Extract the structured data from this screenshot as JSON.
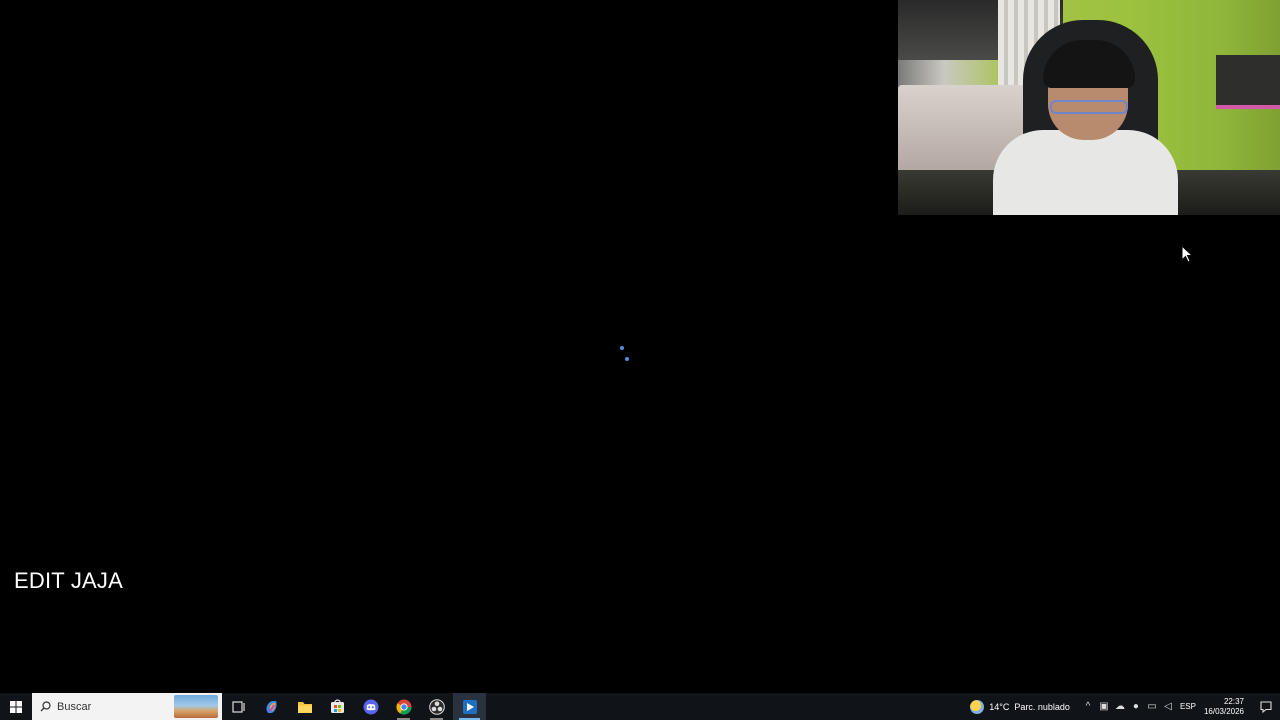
{
  "overlay": {
    "caption": "EDIT JAJA"
  },
  "taskbar": {
    "search_placeholder": "Buscar",
    "pinned": [
      {
        "name": "task-view-icon"
      },
      {
        "name": "copilot-icon"
      },
      {
        "name": "file-explorer-icon"
      },
      {
        "name": "microsoft-store-icon"
      },
      {
        "name": "discord-icon"
      },
      {
        "name": "chrome-icon"
      },
      {
        "name": "obs-icon"
      },
      {
        "name": "active-app-icon"
      }
    ],
    "weather": {
      "temperature": "14°C",
      "condition": "Parc. nublado"
    },
    "language": "ESP",
    "time": "22:37",
    "date": "16/03/2026"
  },
  "colors": {
    "desktop_bg": "#000000",
    "taskbar_bg": "#101318",
    "accent": "#76b9ed",
    "loading_dot": "#4f8fe0"
  }
}
